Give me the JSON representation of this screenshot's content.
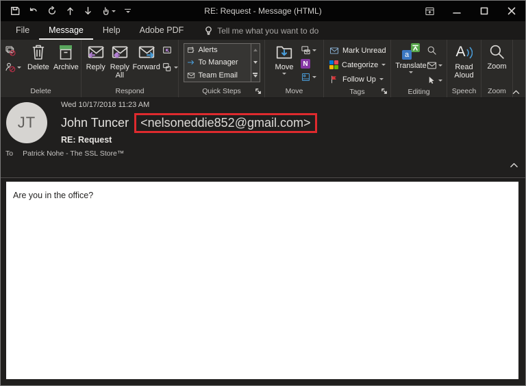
{
  "window": {
    "title": "RE: Request  -  Message (HTML)"
  },
  "menu": {
    "tabs": [
      "File",
      "Message",
      "Help",
      "Adobe PDF"
    ],
    "active_tab": "Message",
    "tell_me": "Tell me what you want to do"
  },
  "ribbon": {
    "delete_group": {
      "label": "Delete",
      "delete": "Delete",
      "archive": "Archive"
    },
    "respond_group": {
      "label": "Respond",
      "reply": "Reply",
      "reply_all": "Reply All",
      "forward": "Forward"
    },
    "quick_steps_group": {
      "label": "Quick Steps",
      "items": [
        "Alerts",
        "To Manager",
        "Team Email"
      ]
    },
    "move_group": {
      "label": "Move",
      "move": "Move"
    },
    "tags_group": {
      "label": "Tags",
      "mark_unread": "Mark Unread",
      "categorize": "Categorize",
      "follow_up": "Follow Up"
    },
    "editing_group": {
      "label": "Editing",
      "translate": "Translate"
    },
    "speech_group": {
      "label": "Speech",
      "read_aloud": "Read Aloud"
    },
    "zoom_group": {
      "label": "Zoom",
      "zoom": "Zoom"
    }
  },
  "message": {
    "avatar_initials": "JT",
    "date": "Wed 10/17/2018 11:23 AM",
    "sender_name": "John Tuncer",
    "sender_email": "<nelsoneddie852@gmail.com>",
    "subject": "RE: Request",
    "to_label": "To",
    "recipient": "Patrick Nohe - The SSL Store™",
    "body_text": "Are you in the office?"
  },
  "icons": {
    "read_aloud_letter": "A",
    "translate_letter": "a",
    "onenote_letter": "N"
  },
  "colors": {
    "highlight_red": "#df2a2e",
    "archive_green": "#58a55c",
    "reply_purple": "#b27fd4",
    "forward_blue": "#4a9edb",
    "onenote_purple": "#8636a4",
    "flag_red": "#d13438",
    "categorize_red": "#e74856",
    "categorize_green": "#6bb700",
    "categorize_blue": "#0078d7",
    "categorize_yellow": "#ffb900"
  }
}
